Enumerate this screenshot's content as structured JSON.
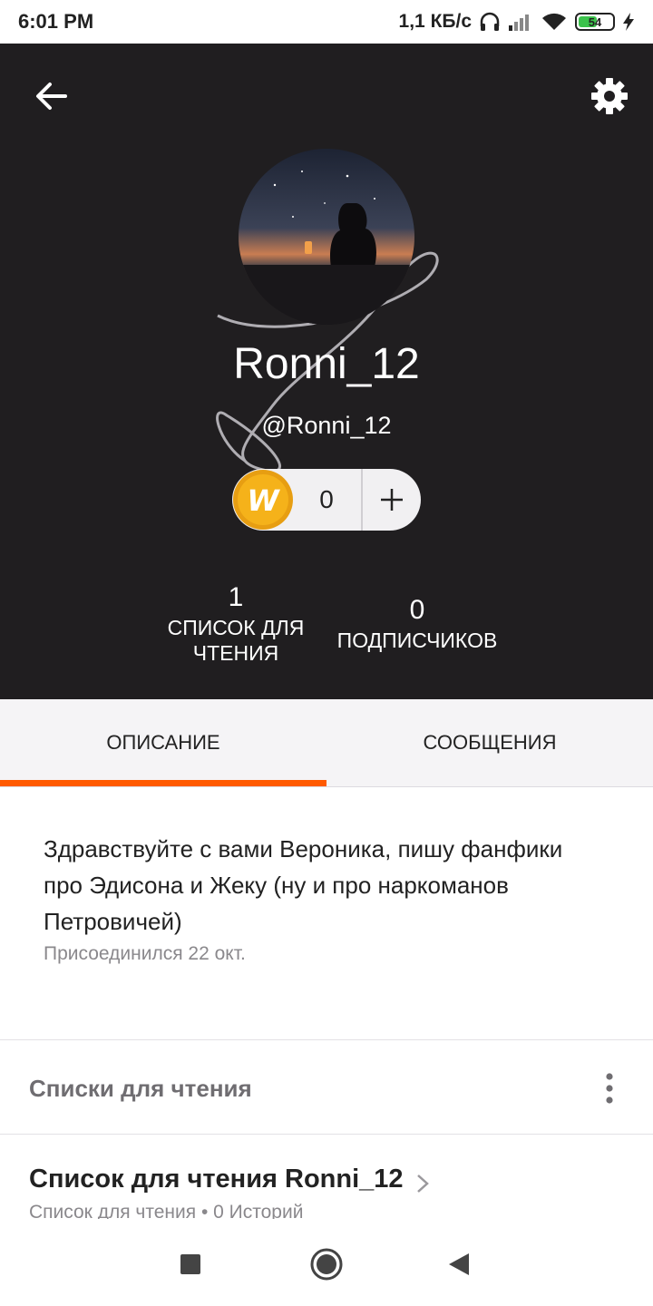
{
  "status_bar": {
    "time": "6:01 PM",
    "network_speed": "1,1 КБ/с",
    "battery": "54",
    "icons": [
      "headphones-icon",
      "signal-icon",
      "wifi-icon",
      "battery-icon",
      "charging-icon"
    ]
  },
  "profile": {
    "username": "Ronni_12",
    "handle": "@Ronni_12",
    "coins": "0",
    "coin_icon_letter": "W",
    "reading_lists_count": "1",
    "reading_lists_label": "СПИСОК ДЛЯ ЧТЕНИЯ",
    "followers_count": "0",
    "followers_label": "ПОДПИСЧИКОВ"
  },
  "tabs": [
    {
      "label": "ОПИСАНИЕ",
      "active": true
    },
    {
      "label": "СООБЩЕНИЯ",
      "active": false
    }
  ],
  "about": {
    "text": "Здравствуйте с вами Вероника, пишу фанфики про Эдисона и Жеку (ну и про наркоманов Петровичей)",
    "joined": "Присоединился 22 окт."
  },
  "reading_lists_section": {
    "title": "Списки для чтения",
    "items": [
      {
        "title": "Список для чтения Ronni_12",
        "subtitle": "Список для чтения • 0 Историй"
      }
    ]
  },
  "colors": {
    "header_bg": "#201e20",
    "accent": "#ff5a00",
    "coin": "#f5b21a"
  }
}
